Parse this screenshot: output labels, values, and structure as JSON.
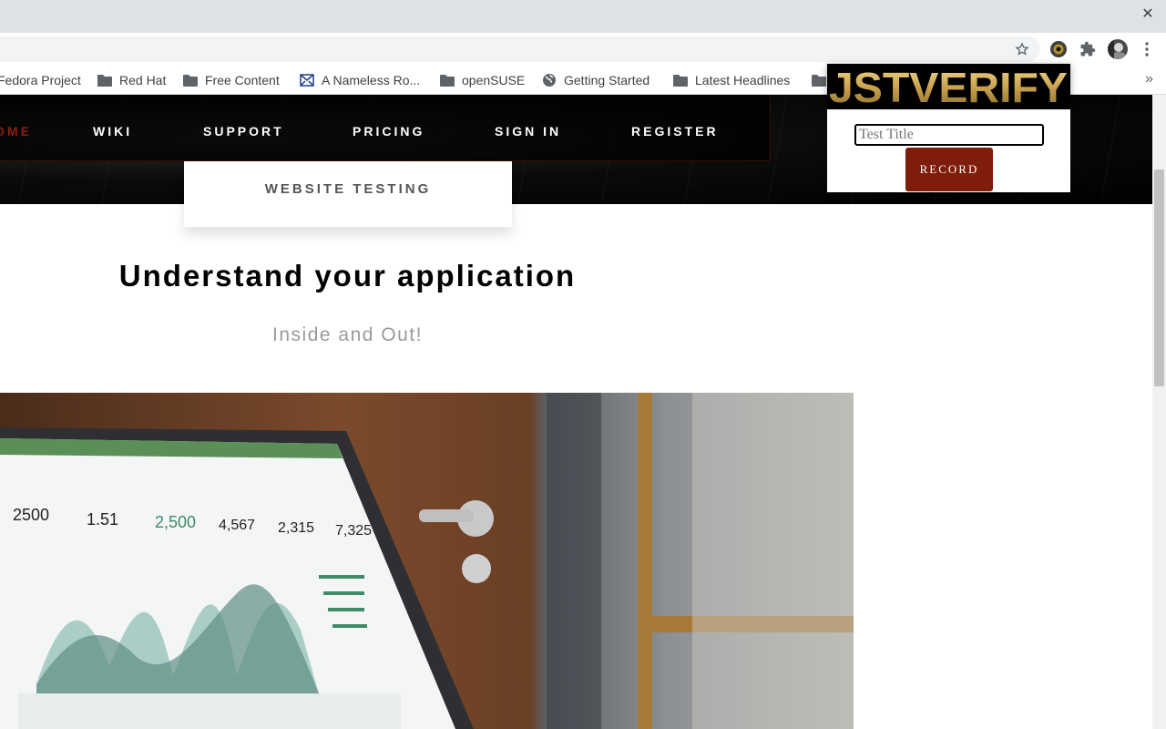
{
  "browser": {
    "close_glyph": "✕",
    "overflow_glyph": "»",
    "bookmarks": [
      {
        "label": "Fedora Project",
        "icon": "none"
      },
      {
        "label": "Red Hat",
        "icon": "folder-icon"
      },
      {
        "label": "Free Content",
        "icon": "folder-icon"
      },
      {
        "label": "A Nameless Ro...",
        "icon": "mail-icon"
      },
      {
        "label": "openSUSE",
        "icon": "folder-icon"
      },
      {
        "label": "Getting Started",
        "icon": "globe-icon"
      },
      {
        "label": "Latest Headlines",
        "icon": "folder-icon"
      }
    ]
  },
  "site": {
    "nav": {
      "home": "HOME",
      "wiki": "WIKI",
      "support": "SUPPORT",
      "pricing": "PRICING",
      "sign_in": "SIGN IN",
      "register": "REGISTER"
    },
    "dropdown_item": "WEBSITE TESTING",
    "headline": "Understand your application",
    "subhead": "Inside and Out!"
  },
  "extension": {
    "logo_text": "JSTVERIFY",
    "title_placeholder": "Test Title",
    "record_label": "RECORD"
  },
  "colors": {
    "accent": "#7f1d0b",
    "nav_active": "#8a1e10",
    "logo_gold": "#d6b86a"
  }
}
